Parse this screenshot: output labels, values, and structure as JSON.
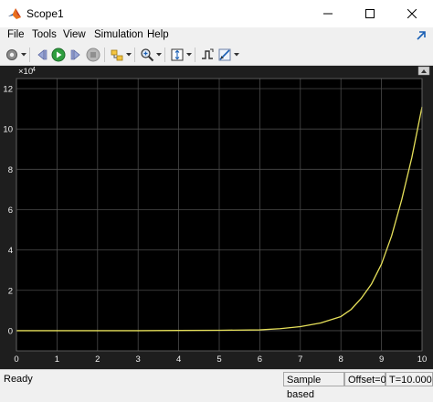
{
  "window": {
    "title": "Scope1",
    "controls": [
      "minimize-icon",
      "maximize-icon",
      "close-icon"
    ]
  },
  "menu": {
    "items": [
      "File",
      "Tools",
      "View",
      "Simulation",
      "Help"
    ]
  },
  "toolbar": {
    "buttons": [
      "settings-icon",
      "step-back-icon",
      "run-icon",
      "step-forward-icon",
      "stop-icon",
      "highlight-block-icon",
      "zoom-icon",
      "autoscale-icon",
      "triggers-icon",
      "cursor-measurements-icon"
    ]
  },
  "chart_data": {
    "type": "line",
    "title": "",
    "xlabel": "",
    "ylabel": "",
    "y_exponent_label": "×10",
    "y_exponent_power": "4",
    "xlim": [
      0,
      10
    ],
    "ylim": [
      -1,
      12.5
    ],
    "x_ticks": [
      "0",
      "1",
      "2",
      "3",
      "4",
      "5",
      "6",
      "7",
      "8",
      "9",
      "10"
    ],
    "y_ticks": [
      "0",
      "2",
      "4",
      "6",
      "8",
      "10",
      "12"
    ],
    "grid": true,
    "series": [
      {
        "color": "#e6e05a",
        "x": [
          0,
          1,
          2,
          3,
          4,
          5,
          6,
          6.5,
          7,
          7.5,
          8,
          8.25,
          8.5,
          8.75,
          9,
          9.25,
          9.5,
          9.75,
          10
        ],
        "y": [
          0,
          0,
          0,
          0,
          0.01,
          0.02,
          0.04,
          0.1,
          0.2,
          0.38,
          0.7,
          1.05,
          1.6,
          2.3,
          3.3,
          4.7,
          6.5,
          8.6,
          11.1
        ]
      }
    ],
    "background": "#000000",
    "axes_color": "#1e1e1e"
  },
  "status": {
    "ready": "Ready",
    "sample_mode": "Sample based",
    "offset": "Offset=0",
    "time": "T=10.000"
  },
  "colors": {
    "line": "#e6e05a",
    "plot_background": "#000000",
    "figure_background": "#1e1e1e",
    "grid": "#4a4a4a"
  }
}
